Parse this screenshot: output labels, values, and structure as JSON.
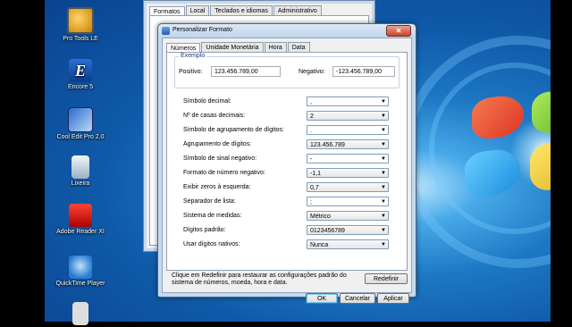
{
  "desktop": {
    "icons": [
      {
        "label": "Pro Tools LE",
        "icon": "pro-tools-icon"
      },
      {
        "label": "Encore 5",
        "icon": "encore-icon"
      },
      {
        "label": "Cool Edit Pro 2.0",
        "icon": "cool-edit-icon"
      },
      {
        "label": "Lixeira",
        "icon": "recycle-bin-icon"
      },
      {
        "label": "Adobe Reader XI",
        "icon": "adobe-reader-icon"
      },
      {
        "label": "QuickTime Player",
        "icon": "quicktime-icon"
      }
    ]
  },
  "background_window": {
    "tabs": [
      "Formatos",
      "Local",
      "Teclados e idiomas",
      "Administrativo"
    ]
  },
  "dialog": {
    "title": "Personalizar Formato",
    "close_label": "✕",
    "tabs": [
      "Números",
      "Unidade Monetária",
      "Hora",
      "Data"
    ],
    "exemplo": {
      "legend": "Exemplo",
      "positive_label": "Positivo:",
      "positive_value": "123.456.789,00",
      "negative_label": "Negativo:",
      "negative_value": "-123.456.789,00"
    },
    "settings": [
      {
        "label": "Símbolo decimal:",
        "value": ","
      },
      {
        "label": "Nº de casas decimais:",
        "value": "2"
      },
      {
        "label": "Símbolo de agrupamento de dígitos:",
        "value": "."
      },
      {
        "label": "Agrupamento de dígitos:",
        "value": "123.456.789"
      },
      {
        "label": "Símbolo de sinal negativo:",
        "value": "-"
      },
      {
        "label": "Formato de número negativo:",
        "value": "-1,1"
      },
      {
        "label": "Exibir zeros à esquerda:",
        "value": "0,7"
      },
      {
        "label": "Separador de lista:",
        "value": ";"
      },
      {
        "label": "Sistema de medidas:",
        "value": "Métrico"
      },
      {
        "label": "Dígitos padrão:",
        "value": "0123456789"
      },
      {
        "label": "Usar dígitos nativos:",
        "value": "Nunca"
      }
    ],
    "note": "Clique em Redefinir para restaurar as configurações padrão do sistema de números, moeda, hora e data.",
    "reset_label": "Redefinir",
    "ok_label": "OK",
    "cancel_label": "Cancelar",
    "apply_label": "Aplicar"
  }
}
